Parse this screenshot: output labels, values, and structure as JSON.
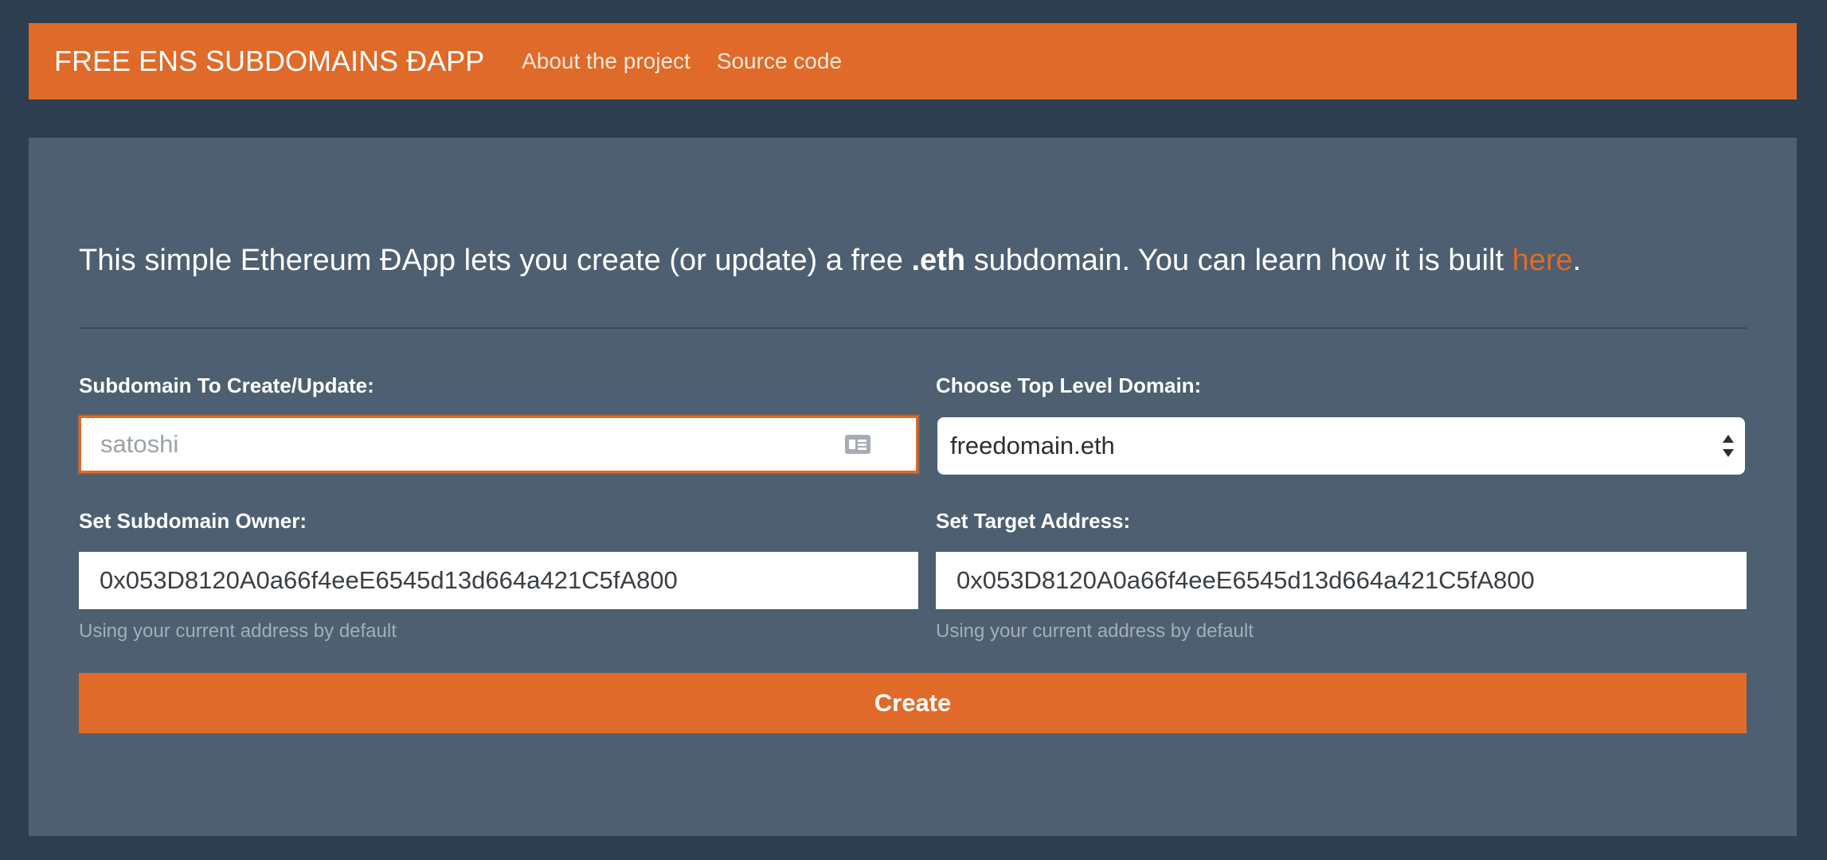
{
  "navbar": {
    "brand": "FREE ENS SUBDOMAINS ĐAPP",
    "links": [
      "About the project",
      "Source code"
    ]
  },
  "intro": {
    "text_before": "This simple Ethereum ĐApp lets you create (or update) a free ",
    "emphasis": ".eth",
    "text_middle": " subdomain. You can learn how it is built ",
    "link": "here",
    "text_after": "."
  },
  "form": {
    "subdomain": {
      "label": "Subdomain To Create/Update:",
      "value": "",
      "placeholder": "satoshi"
    },
    "tld": {
      "label": "Choose Top Level Domain:",
      "selected": "freedomain.eth"
    },
    "owner": {
      "label": "Set Subdomain Owner:",
      "value": "0x053D8120A0a66f4eeE6545d13d664a421C5fA800",
      "help": "Using your current address by default"
    },
    "target": {
      "label": "Set Target Address:",
      "value": "0x053D8120A0a66f4eeE6545d13d664a421C5fA800",
      "help": "Using your current address by default"
    },
    "submit_label": "Create"
  },
  "colors": {
    "accent": "#df6a29",
    "background": "#2c3e50",
    "panel": "#4d5f70"
  }
}
